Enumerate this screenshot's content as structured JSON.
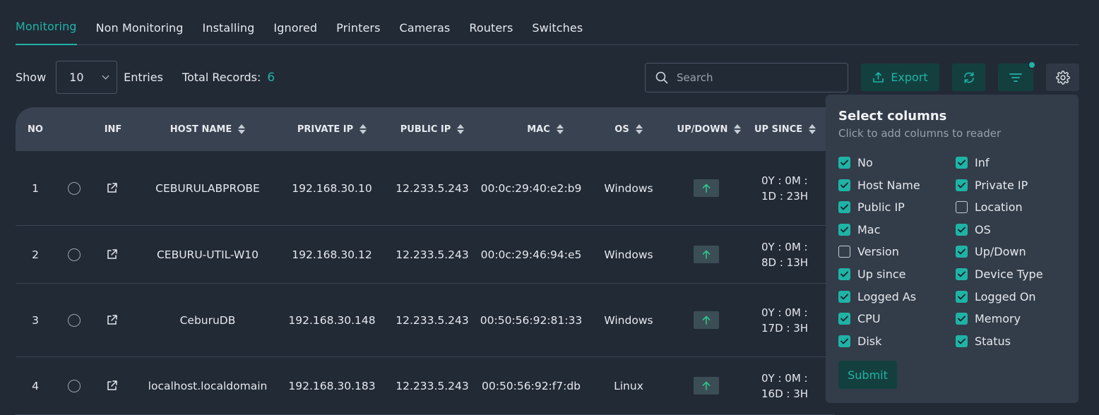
{
  "tabs": [
    {
      "label": "Monitoring",
      "active": true
    },
    {
      "label": "Non Monitoring",
      "active": false
    },
    {
      "label": "Installing",
      "active": false
    },
    {
      "label": "Ignored",
      "active": false
    },
    {
      "label": "Printers",
      "active": false
    },
    {
      "label": "Cameras",
      "active": false
    },
    {
      "label": "Routers",
      "active": false
    },
    {
      "label": "Switches",
      "active": false
    }
  ],
  "toolbar": {
    "show_label": "Show",
    "entries_value": "10",
    "entries_label": "Entries",
    "total_label": "Total Records:",
    "total_value": "6",
    "search_placeholder": "Search",
    "export_label": "Export"
  },
  "table": {
    "headers": [
      "NO",
      "INF",
      "HOST NAME",
      "PRIVATE IP",
      "PUBLIC IP",
      "MAC",
      "OS",
      "UP/DOWN",
      "UP SINCE"
    ],
    "rows": [
      {
        "no": "1",
        "host": "CEBURULABPROBE",
        "private_ip": "192.168.30.10",
        "public_ip": "12.233.5.243",
        "mac": "00:0c:29:40:e2:b9",
        "os": "Windows",
        "since1": "0Y : 0M :",
        "since2": "1D : 23H"
      },
      {
        "no": "2",
        "host": "CEBURU-UTIL-W10",
        "private_ip": "192.168.30.12",
        "public_ip": "12.233.5.243",
        "mac": "00:0c:29:46:94:e5",
        "os": "Windows",
        "since1": "0Y : 0M :",
        "since2": "8D : 13H"
      },
      {
        "no": "3",
        "host": "CeburuDB",
        "private_ip": "192.168.30.148",
        "public_ip": "12.233.5.243",
        "mac": "00:50:56:92:81:33",
        "os": "Windows",
        "since1": "0Y : 0M :",
        "since2": "17D : 3H"
      },
      {
        "no": "4",
        "host": "localhost.localdomain",
        "private_ip": "192.168.30.183",
        "public_ip": "12.233.5.243",
        "mac": "00:50:56:92:f7:db",
        "os": "Linux",
        "since1": "0Y : 0M :",
        "since2": "16D : 3H"
      }
    ]
  },
  "column_panel": {
    "title": "Select columns",
    "subtitle": "Click to add columns to reader",
    "options": [
      {
        "label": "No",
        "checked": true
      },
      {
        "label": "Inf",
        "checked": true
      },
      {
        "label": "Host Name",
        "checked": true
      },
      {
        "label": "Private IP",
        "checked": true
      },
      {
        "label": "Public IP",
        "checked": true
      },
      {
        "label": "Location",
        "checked": false
      },
      {
        "label": "Mac",
        "checked": true
      },
      {
        "label": "OS",
        "checked": true
      },
      {
        "label": "Version",
        "checked": false
      },
      {
        "label": "Up/Down",
        "checked": true
      },
      {
        "label": "Up since",
        "checked": true
      },
      {
        "label": "Device Type",
        "checked": true
      },
      {
        "label": "Logged As",
        "checked": true
      },
      {
        "label": "Logged On",
        "checked": true
      },
      {
        "label": "CPU",
        "checked": true
      },
      {
        "label": "Memory",
        "checked": true
      },
      {
        "label": "Disk",
        "checked": true
      },
      {
        "label": "Status",
        "checked": true
      }
    ],
    "submit_label": "Submit"
  },
  "colors": {
    "accent": "#1fb3a6",
    "background": "#222a36",
    "header_bg": "#394250",
    "panel_bg": "#333c49",
    "up_arrow": "#2fc48d"
  },
  "icons": [
    "search-icon",
    "upload-icon",
    "refresh-icon",
    "filter-icon",
    "gear-icon",
    "external-link-icon",
    "arrow-up-icon",
    "chevron-down-icon",
    "checkmark-icon"
  ]
}
